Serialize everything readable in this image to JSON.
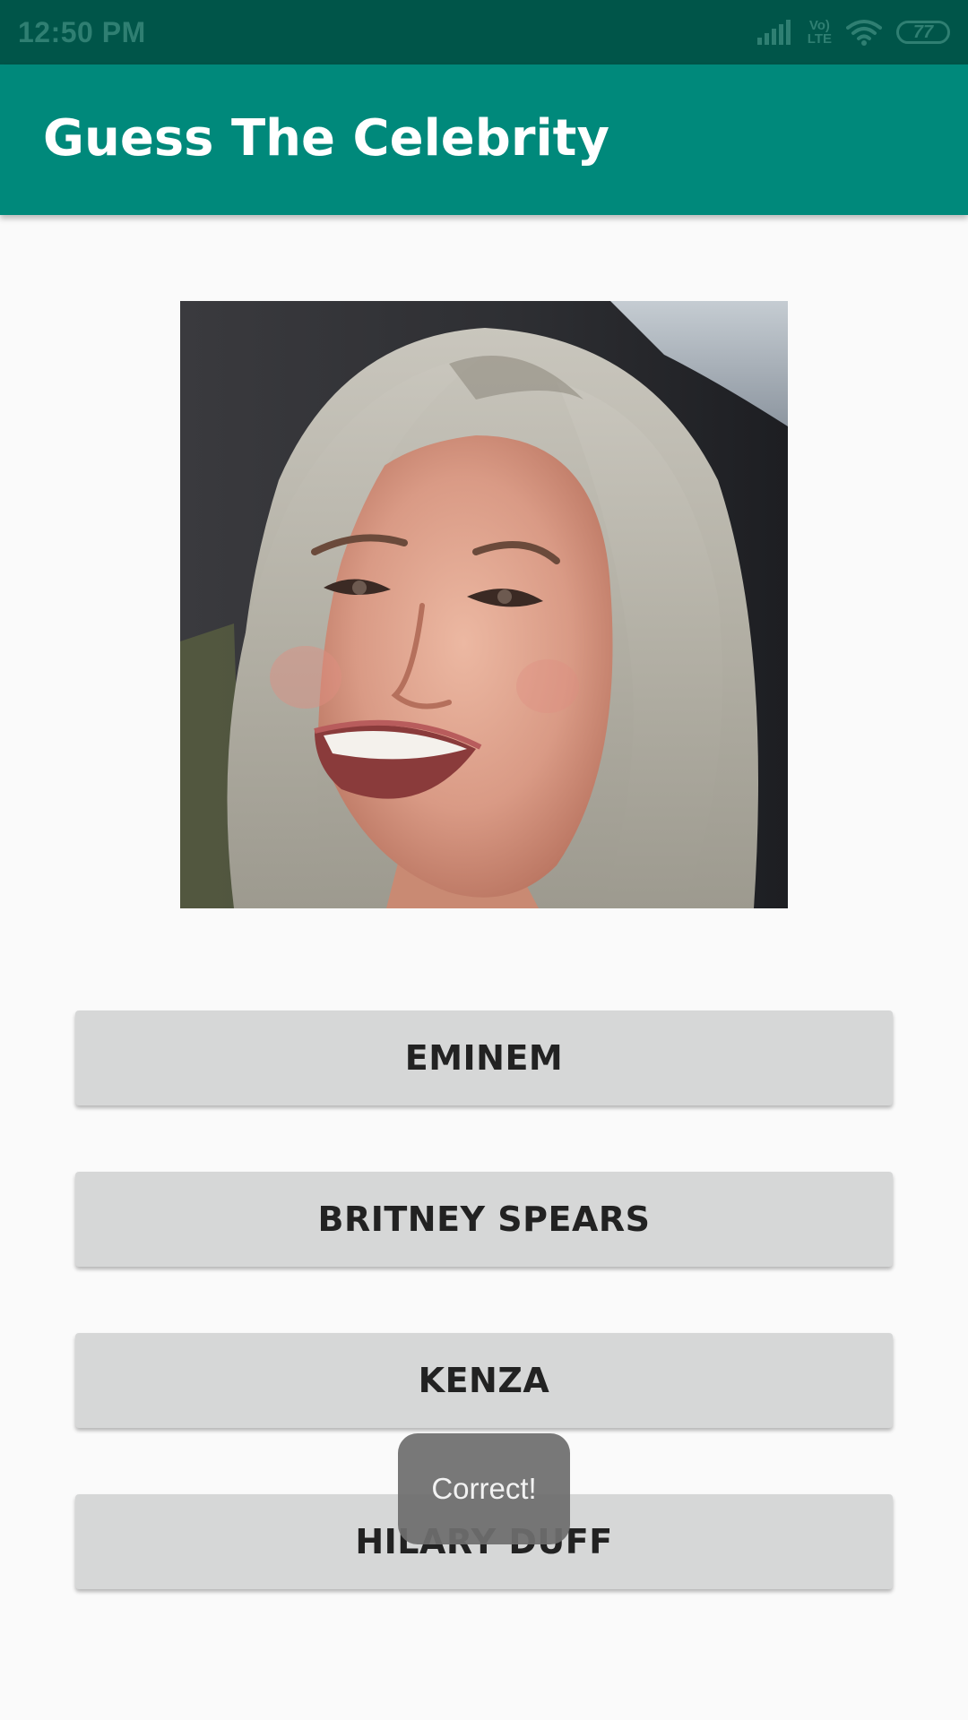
{
  "status_bar": {
    "time": "12:50 PM",
    "volte_top": "Vo)",
    "volte_bottom": "LTE",
    "battery": "77",
    "icons": [
      "signal-icon",
      "volte-icon",
      "wifi-icon",
      "battery-icon"
    ]
  },
  "app_bar": {
    "title": "Guess The Celebrity",
    "color": "#00897b"
  },
  "celebrity_image": {
    "icon": "celebrity-photo"
  },
  "answers": [
    {
      "label": "EMINEM"
    },
    {
      "label": "BRITNEY SPEARS"
    },
    {
      "label": "KENZA"
    },
    {
      "label": "HILARY DUFF"
    }
  ],
  "toast": {
    "message": "Correct!"
  }
}
